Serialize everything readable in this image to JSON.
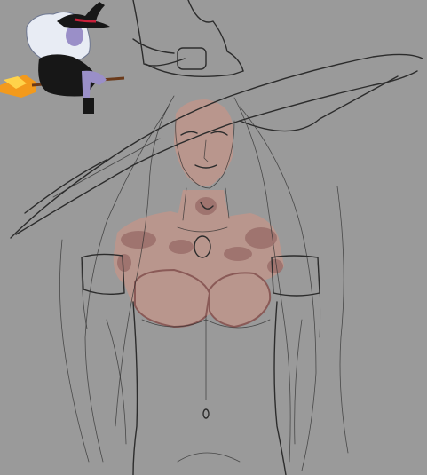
{
  "canvas": {
    "background": "#9a9a9a",
    "sketch_line_color": "#2c2c2c",
    "skin_base_color": "#b9968d",
    "skin_shadow_color": "#8a5a57"
  },
  "reference_thumbnail": {
    "subject": "witch-on-broom-reference",
    "colors": {
      "hair": "#e8ecf4",
      "outfit": "#171717",
      "hat_band": "#c8203a",
      "broom_flame": "#f39a1c",
      "skin": "#9a8fc8"
    }
  }
}
